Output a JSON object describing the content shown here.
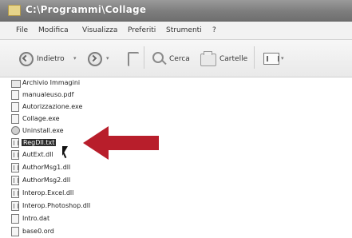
{
  "window": {
    "title": "C:\\Programmi\\Collage",
    "title_icon": "folder-icon"
  },
  "menu": [
    "File",
    "Modifica",
    "Visualizza",
    "Preferiti",
    "Strumenti",
    "?"
  ],
  "toolbar": {
    "back_label": "Indietro",
    "search_label": "Cerca",
    "folders_label": "Cartelle"
  },
  "files": [
    {
      "name": "Archivio Immagini",
      "icon": "folder-icon"
    },
    {
      "name": "manualeuso.pdf",
      "icon": "pdf-icon"
    },
    {
      "name": "Autorizzazione.exe",
      "icon": "exe-icon"
    },
    {
      "name": "Collage.exe",
      "icon": "exe-icon"
    },
    {
      "name": "Uninstall.exe",
      "icon": "gear-icon"
    },
    {
      "name": "RegDll.txt",
      "icon": "dll-icon",
      "selected": true
    },
    {
      "name": "AutExt.dll",
      "icon": "dll-icon"
    },
    {
      "name": "AuthorMsg1.dll",
      "icon": "dll-icon"
    },
    {
      "name": "AuthorMsg2.dll",
      "icon": "dll-icon"
    },
    {
      "name": "Interop.Excel.dll",
      "icon": "dll-icon"
    },
    {
      "name": "Interop.Photoshop.dll",
      "icon": "dll-icon"
    },
    {
      "name": "Intro.dat",
      "icon": "file-icon"
    },
    {
      "name": "base0.ord",
      "icon": "file-icon"
    }
  ],
  "colors": {
    "accent_arrow": "#b81e2b",
    "selection": "#2b2b2b"
  }
}
